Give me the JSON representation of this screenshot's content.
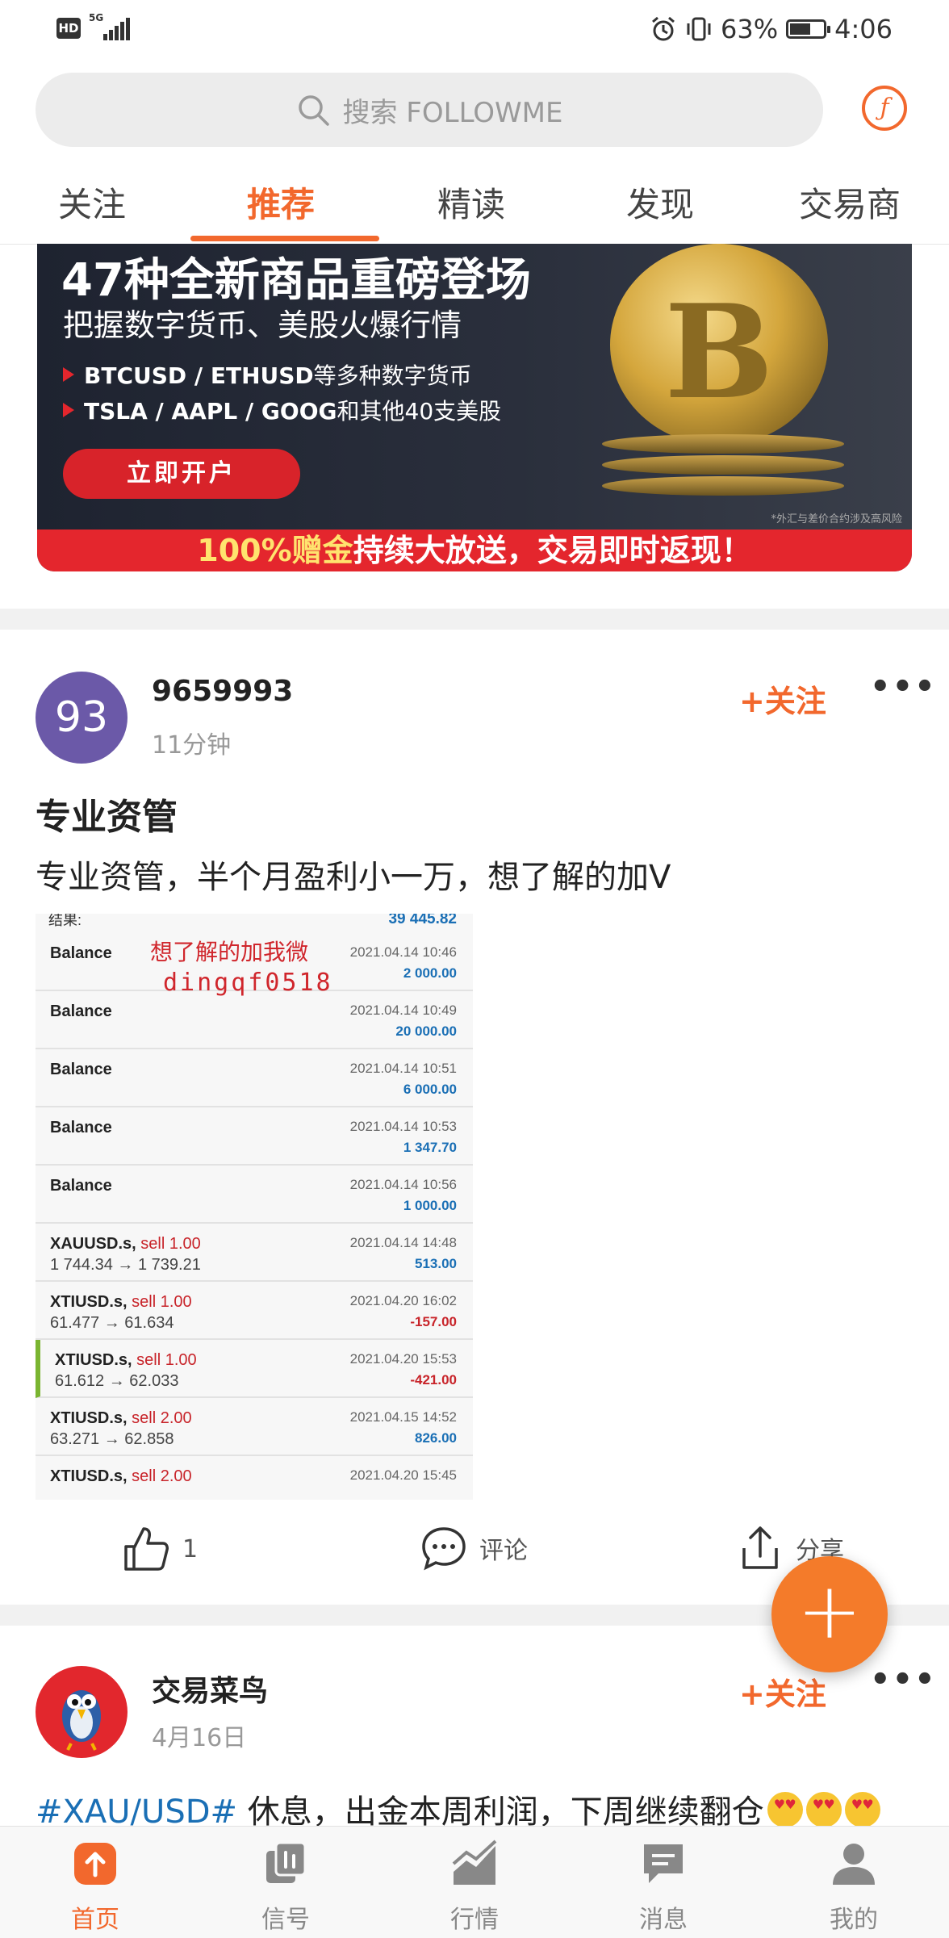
{
  "status_bar": {
    "hd": "HD",
    "network": "5G",
    "battery": "63%",
    "battery_level": 0.63,
    "time": "4:06"
  },
  "search": {
    "placeholder": "搜索 FOLLOWME"
  },
  "tabs": [
    {
      "label": "关注",
      "active": false
    },
    {
      "label": "推荐",
      "active": true
    },
    {
      "label": "精读",
      "active": false
    },
    {
      "label": "发现",
      "active": false
    },
    {
      "label": "交易商",
      "active": false
    }
  ],
  "banner": {
    "title": "47种全新商品重磅登场",
    "subtitle": "把握数字货币、美股火爆行情",
    "line1_bold": "BTCUSD / ETHUSD",
    "line1_rest": "等多种数字货币",
    "line2_bold": "TSLA / AAPL / GOOG",
    "line2_rest": "和其他40支美股",
    "button": "立即开户",
    "note": "*外汇与差价合约涉及高风险",
    "footer_highlight": "100%赠金",
    "footer_rest": "持续大放送，交易即时返现！"
  },
  "posts": [
    {
      "avatar_text": "93",
      "username": "9659993",
      "time": "11分钟",
      "follow": "+关注",
      "title": "专业资管",
      "body": "专业资管，半个月盈利小一万，想了解的加V",
      "image": {
        "top_left": "结果:",
        "top_right": "39 445.82",
        "watermark_line1": "想了解的加我微",
        "watermark_line2": "dingqf0518",
        "rows": [
          {
            "symbol": "Balance",
            "side": "",
            "prices": "",
            "date": "2021.04.14 10:46",
            "amount": "2 000.00",
            "positive": true,
            "marked": false
          },
          {
            "symbol": "Balance",
            "side": "",
            "prices": "",
            "date": "2021.04.14 10:49",
            "amount": "20 000.00",
            "positive": true,
            "marked": false
          },
          {
            "symbol": "Balance",
            "side": "",
            "prices": "",
            "date": "2021.04.14 10:51",
            "amount": "6 000.00",
            "positive": true,
            "marked": false
          },
          {
            "symbol": "Balance",
            "side": "",
            "prices": "",
            "date": "2021.04.14 10:53",
            "amount": "1 347.70",
            "positive": true,
            "marked": false
          },
          {
            "symbol": "Balance",
            "side": "",
            "prices": "",
            "date": "2021.04.14 10:56",
            "amount": "1 000.00",
            "positive": true,
            "marked": false
          },
          {
            "symbol": "XAUUSD.s,",
            "side": "sell 1.00",
            "prices": "1 744.34 → 1 739.21",
            "date": "2021.04.14 14:48",
            "amount": "513.00",
            "positive": true,
            "marked": false
          },
          {
            "symbol": "XTIUSD.s,",
            "side": "sell 1.00",
            "prices": "61.477 → 61.634",
            "date": "2021.04.20 16:02",
            "amount": "-157.00",
            "positive": false,
            "marked": false
          },
          {
            "symbol": "XTIUSD.s,",
            "side": "sell 1.00",
            "prices": "61.612 → 62.033",
            "date": "2021.04.20 15:53",
            "amount": "-421.00",
            "positive": false,
            "marked": true
          },
          {
            "symbol": "XTIUSD.s,",
            "side": "sell 2.00",
            "prices": "63.271 → 62.858",
            "date": "2021.04.15 14:52",
            "amount": "826.00",
            "positive": true,
            "marked": false
          },
          {
            "symbol": "XTIUSD.s,",
            "side": "sell 2.00",
            "prices": "",
            "date": "2021.04.20 15:45",
            "amount": "",
            "positive": true,
            "marked": false
          }
        ]
      },
      "actions": {
        "likes": "1",
        "comment": "评论",
        "share": "分享"
      }
    },
    {
      "username": "交易菜鸟",
      "time": "4月16日",
      "follow": "+关注",
      "hashtag": "#XAU/USD#",
      "body": " 休息，出金本周利润，下周继续翻仓"
    }
  ],
  "bottom_nav": [
    {
      "label": "首页",
      "icon": "home-upload-icon",
      "active": true
    },
    {
      "label": "信号",
      "icon": "signal-icon",
      "active": false
    },
    {
      "label": "行情",
      "icon": "market-chart-icon",
      "active": false
    },
    {
      "label": "消息",
      "icon": "message-icon",
      "active": false
    },
    {
      "label": "我的",
      "icon": "profile-icon",
      "active": false
    }
  ],
  "colors": {
    "accent": "#f2682d",
    "fab": "#f47b2a",
    "banner_red": "#e4262d",
    "link_blue": "#1a6fb5",
    "loss_red": "#c8242a"
  }
}
